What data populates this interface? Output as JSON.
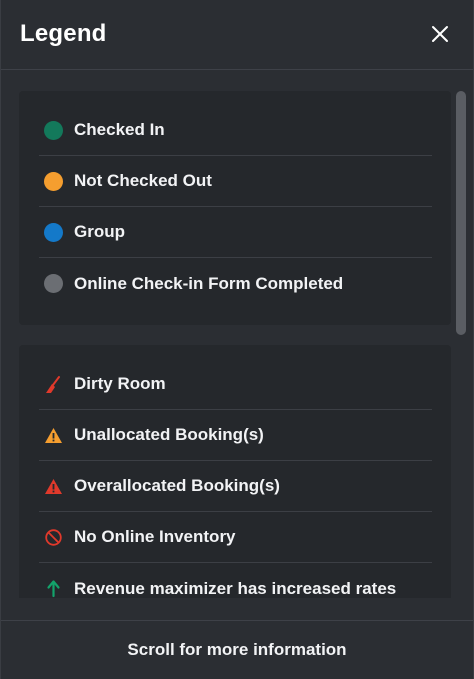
{
  "header": {
    "title": "Legend",
    "close_icon": "close-icon"
  },
  "status_legend": {
    "items": [
      {
        "label": "Checked In",
        "color": "#13795b"
      },
      {
        "label": "Not Checked Out",
        "color": "#f59e2f"
      },
      {
        "label": "Group",
        "color": "#1479c9"
      },
      {
        "label": "Online Check-in Form Completed",
        "color": "#6b6e73"
      }
    ]
  },
  "indicator_legend": {
    "items": [
      {
        "label": "Dirty Room",
        "icon": "broom-icon",
        "color": "#e0392b"
      },
      {
        "label": "Unallocated Booking(s)",
        "icon": "warning-triangle-icon",
        "color": "#f59e2f"
      },
      {
        "label": "Overallocated Booking(s)",
        "icon": "warning-triangle-icon",
        "color": "#e0392b"
      },
      {
        "label": "No Online Inventory",
        "icon": "prohibited-icon",
        "color": "#e0392b"
      },
      {
        "label": "Revenue maximizer has increased rates",
        "icon": "arrow-up-icon",
        "color": "#13a36b"
      }
    ]
  },
  "footer": {
    "text": "Scroll for more information"
  }
}
